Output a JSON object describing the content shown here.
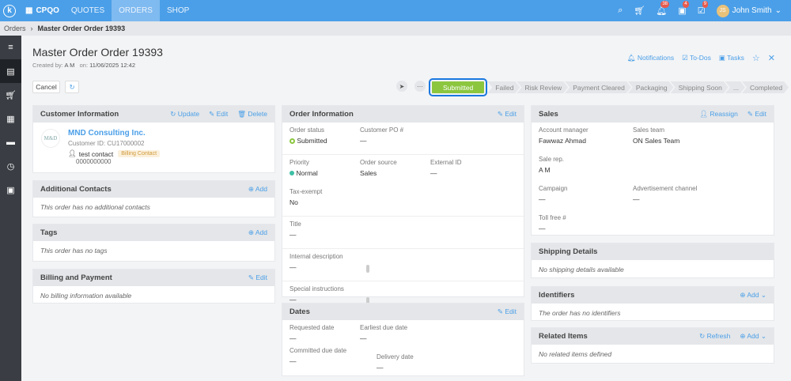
{
  "topbar": {
    "brand": "CPQO",
    "nav": [
      "QUOTES",
      "ORDERS",
      "SHOP"
    ],
    "active": "ORDERS",
    "badges": {
      "notifications": "38",
      "todos": "4",
      "tasks": "9"
    },
    "user": "John Smith",
    "initials": "JS"
  },
  "breadcrumb": {
    "root": "Orders",
    "current": "Master Order Order 19393"
  },
  "header": {
    "title": "Master Order Order 19393",
    "created_by_label": "Created by:",
    "created_by": "A M",
    "on_label": "on:",
    "created_on": "11/06/2025 12:42",
    "cancel": "Cancel",
    "links": [
      "Notifications",
      "To-Dos",
      "Tasks"
    ]
  },
  "pipeline": [
    "Submitted",
    "Failed",
    "Risk Review",
    "Payment Cleared",
    "Packaging",
    "Shipping Soon",
    "...",
    "Completed"
  ],
  "customer": {
    "title": "Customer Information",
    "update": "Update",
    "edit": "Edit",
    "delete": "Delete",
    "name": "MND Consulting Inc.",
    "id_label": "Customer ID:",
    "id": "CU17000002",
    "contact": "test contact",
    "contact_badge": "Billing Contact",
    "phone": "0000000000",
    "logo": "M&D"
  },
  "additional": {
    "title": "Additional Contacts",
    "add": "Add",
    "empty": "This order has no additional contacts"
  },
  "tags": {
    "title": "Tags",
    "add": "Add",
    "empty": "This order has no tags"
  },
  "billing": {
    "title": "Billing and Payment",
    "edit": "Edit",
    "empty": "No billing information available"
  },
  "order": {
    "title": "Order Information",
    "edit": "Edit",
    "status_l": "Order status",
    "status": "Submitted",
    "po_l": "Customer PO #",
    "po": "—",
    "priority_l": "Priority",
    "priority": "Normal",
    "source_l": "Order source",
    "source": "Sales",
    "ext_l": "External ID",
    "ext": "—",
    "tax_l": "Tax-exempt",
    "tax": "No",
    "title_l": "Title",
    "title_v": "—",
    "desc_l": "Internal description",
    "desc": "—",
    "spec_l": "Special instructions",
    "spec": "—"
  },
  "dates": {
    "title": "Dates",
    "edit": "Edit",
    "req_l": "Requested date",
    "req": "—",
    "earliest_l": "Earliest due date",
    "earliest": "—",
    "committed_l": "Committed due date",
    "committed": "—",
    "delivery_l": "Delivery date",
    "delivery": "—"
  },
  "sales": {
    "title": "Sales",
    "reassign": "Reassign",
    "edit": "Edit",
    "am_l": "Account manager",
    "am": "Fawwaz Ahmad",
    "team_l": "Sales team",
    "team": "ON Sales Team",
    "rep_l": "Sale rep.",
    "rep": "A M",
    "camp_l": "Campaign",
    "camp": "—",
    "adv_l": "Advertisement channel",
    "adv": "—",
    "toll_l": "Toll free #",
    "toll": "—"
  },
  "shipping": {
    "title": "Shipping Details",
    "empty": "No shipping details available"
  },
  "identifiers": {
    "title": "Identifiers",
    "add": "Add",
    "empty": "The order has no identifiers"
  },
  "related": {
    "title": "Related Items",
    "refresh": "Refresh",
    "add": "Add",
    "empty": "No related items defined"
  },
  "colors": {
    "primary": "#4b9fe8",
    "submitted": "#8cc63f",
    "priority": "#3dbfa5"
  }
}
